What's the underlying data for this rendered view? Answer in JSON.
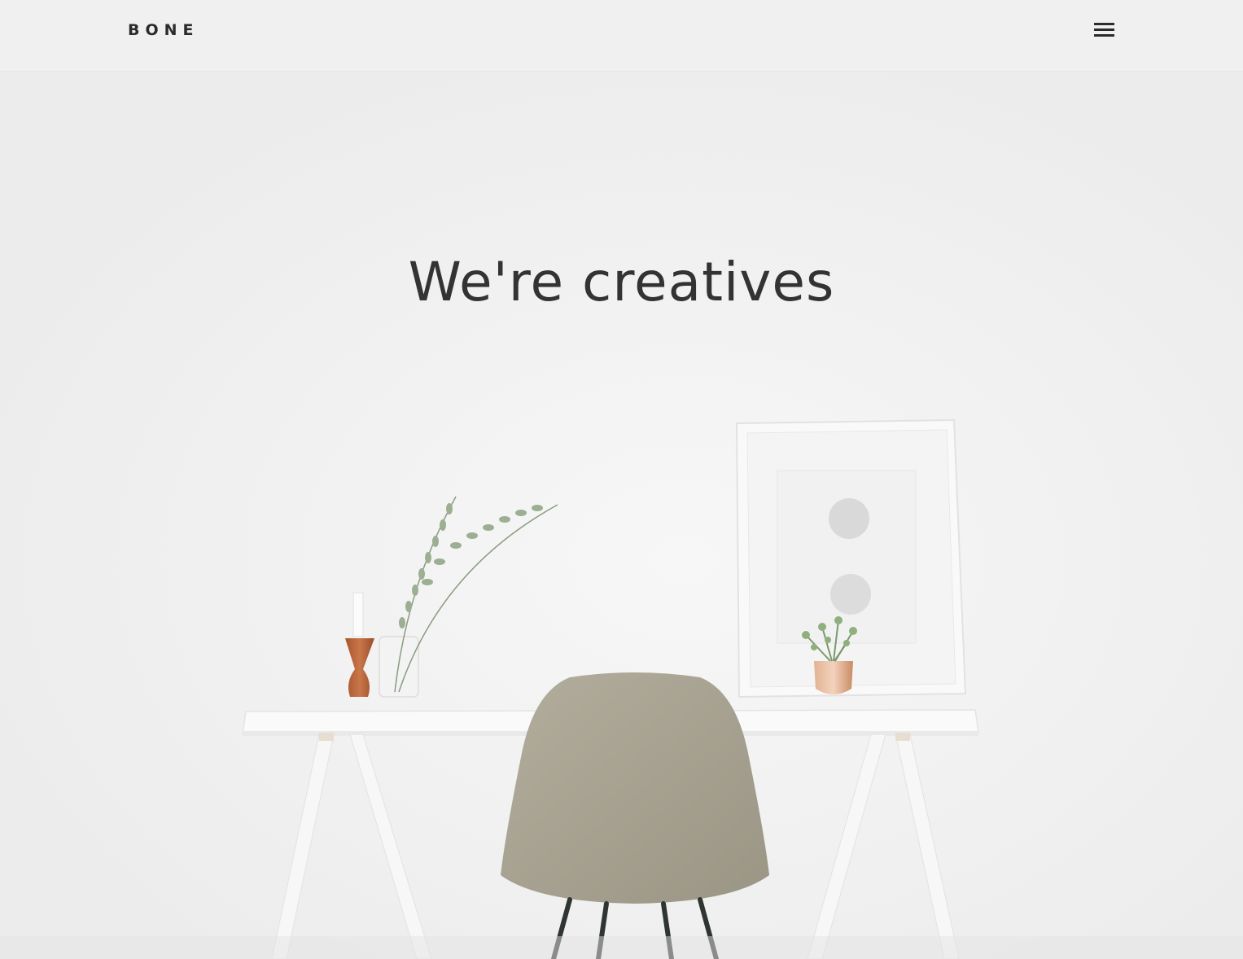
{
  "header": {
    "logo_text": "BONE",
    "menu_icon": "hamburger-menu-icon"
  },
  "hero": {
    "title": "We're creatives",
    "image_subject": "white desk with beige chair, framed print, plant and candle"
  },
  "colors": {
    "background": "#efefef",
    "text": "#333333",
    "chair": "#a8a392",
    "copper": "#c9845c"
  }
}
